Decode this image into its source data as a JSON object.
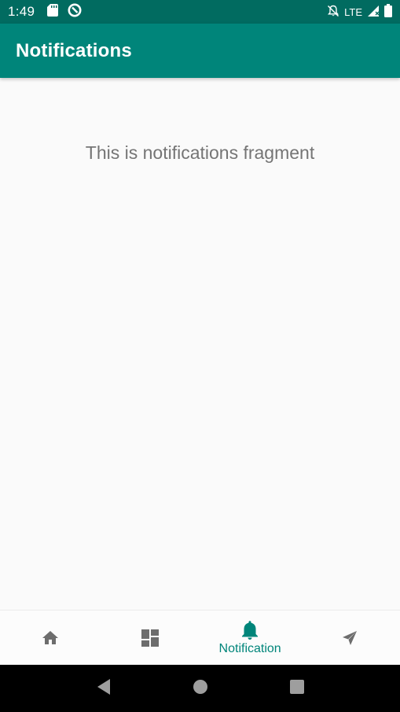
{
  "status_bar": {
    "time": "1:49",
    "network": "LTE",
    "icons": [
      "sd-card-icon",
      "sync-icon",
      "notifications-off-icon",
      "signal-icon",
      "battery-icon"
    ]
  },
  "app_bar": {
    "title": "Notifications",
    "background_color": "#00857a"
  },
  "content": {
    "message": "This is notifications fragment"
  },
  "bottom_nav": {
    "items": [
      {
        "id": "home",
        "icon": "home-icon",
        "label": "",
        "active": false
      },
      {
        "id": "dashboard",
        "icon": "dashboard-icon",
        "label": "",
        "active": false
      },
      {
        "id": "notification",
        "icon": "bell-icon",
        "label": "Notification",
        "active": true
      },
      {
        "id": "send",
        "icon": "send-icon",
        "label": "",
        "active": false
      }
    ],
    "active_color": "#00857a",
    "inactive_color": "#6d6d6d"
  },
  "system_nav": {
    "buttons": [
      "back-icon",
      "home-circle-icon",
      "recents-icon"
    ]
  }
}
